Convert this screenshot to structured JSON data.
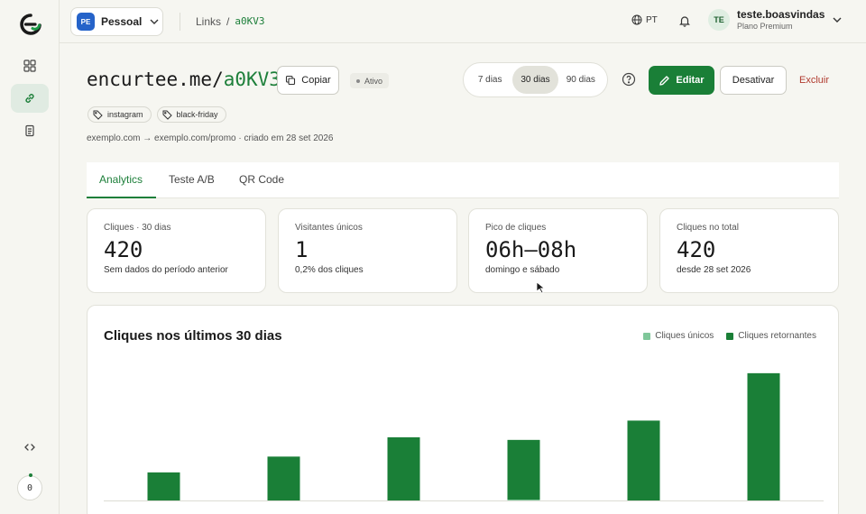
{
  "sidebar": {
    "items": [
      {
        "icon": "grid-icon"
      },
      {
        "icon": "link-icon",
        "active": true
      },
      {
        "icon": "document-icon"
      }
    ],
    "code_icon": "code-icon",
    "counter": "0"
  },
  "topbar": {
    "workspace": {
      "avatar": "PE",
      "name": "Pessoal"
    },
    "breadcrumb": {
      "parent": "Links",
      "separator": "/",
      "current": "a0KV3"
    },
    "language": "PT",
    "user": {
      "avatar": "TE",
      "name": "teste.boasvindas",
      "plan": "Plano Premium"
    }
  },
  "link": {
    "domain": "encurtee.me/",
    "code": "a0KV3",
    "copy_label": "Copiar",
    "status": "Ativo",
    "tags": [
      "instagram",
      "black-friday"
    ],
    "meta": "exemplo.com → exemplo.com/promo · criado em 28 set 2026"
  },
  "range": {
    "options": [
      "7 dias",
      "30 dias",
      "90 dias"
    ],
    "selected": "30 dias"
  },
  "actions": {
    "edit": "Editar",
    "deactivate": "Desativar",
    "delete": "Excluir"
  },
  "tabs": [
    {
      "label": "Analytics",
      "active": true
    },
    {
      "label": "Teste A/B",
      "active": false
    },
    {
      "label": "QR Code",
      "active": false
    }
  ],
  "stats": [
    {
      "label": "Cliques · 30 dias",
      "value": "420",
      "sub": "Sem dados do período anterior"
    },
    {
      "label": "Visitantes únicos",
      "value": "1",
      "sub": "0,2% dos cliques"
    },
    {
      "label": "Pico de cliques",
      "value": "06h–08h",
      "sub": "domingo e sábado"
    },
    {
      "label": "Cliques no total",
      "value": "420",
      "sub": "desde 28 set 2026"
    }
  ],
  "colors": {
    "accent": "#1a7f37",
    "unique": "#7fc79a",
    "returning": "#1a7f37",
    "delete": "#b03a2e"
  },
  "chart_data": {
    "type": "bar",
    "title": "Cliques nos últimos 30 dias",
    "series": [
      {
        "name": "Cliques únicos",
        "values": [
          0,
          0,
          0,
          1,
          0,
          0
        ]
      },
      {
        "name": "Cliques retornantes",
        "values": [
          32,
          50,
          72,
          68,
          91,
          145
        ]
      }
    ],
    "stacked": true,
    "ylim": [
      0,
      150
    ],
    "grid": false,
    "legend": "top-right"
  }
}
